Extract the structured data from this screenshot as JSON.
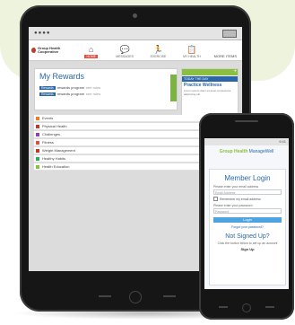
{
  "tablet": {
    "logo_text": "Group Health Cooperative",
    "nav": [
      {
        "label": "HOME",
        "icon": "home-icon",
        "active": true
      },
      {
        "label": "MESSAGES",
        "icon": "chat-icon"
      },
      {
        "label": "EXERCISE",
        "icon": "runner-icon"
      },
      {
        "label": "MY HEALTH",
        "icon": "clipboard-icon"
      },
      {
        "label": "MORE ITEMS",
        "text": true
      }
    ],
    "rewards": {
      "title": "My Rewards",
      "rows": [
        {
          "pill": "Rewards",
          "text": "rewards program",
          "pts": "see rules"
        },
        {
          "pill": "Rewards",
          "text": "rewards program",
          "pts": "see rules"
        }
      ]
    },
    "side": {
      "sub": "TODAY THE DAY",
      "name": "Practice Wellness",
      "meta": "Lorem ipsum dolor sit amet consectetur adipiscing elit"
    },
    "list": [
      {
        "label": "Events",
        "color": "#e67e22"
      },
      {
        "label": "Physical Health",
        "color": "#c0392b"
      },
      {
        "label": "Challenges",
        "color": "#8e44ad"
      },
      {
        "label": "Fitness",
        "color": "#e74c3c"
      },
      {
        "label": "Weight Management",
        "color": "#c0392b"
      },
      {
        "label": "Healthy Habits",
        "color": "#27ae60"
      },
      {
        "label": "Health Education",
        "color": "#8bbf3f"
      }
    ]
  },
  "phone": {
    "status": "9:41",
    "logo_brand": "Group Health",
    "logo_suffix": "ManageWell",
    "title": "Member Login",
    "email_label": "Please enter your email address",
    "email_placeholder": "Email Address",
    "remember_label": "Remember my email address",
    "password_label": "Please enter your password",
    "password_placeholder": "Password",
    "login_button": "Login",
    "forgot_link": "Forgot your password?",
    "not_signed_up": "Not Signed Up?",
    "note": "Click the button below to set up an account",
    "signup": "Sign Up"
  }
}
